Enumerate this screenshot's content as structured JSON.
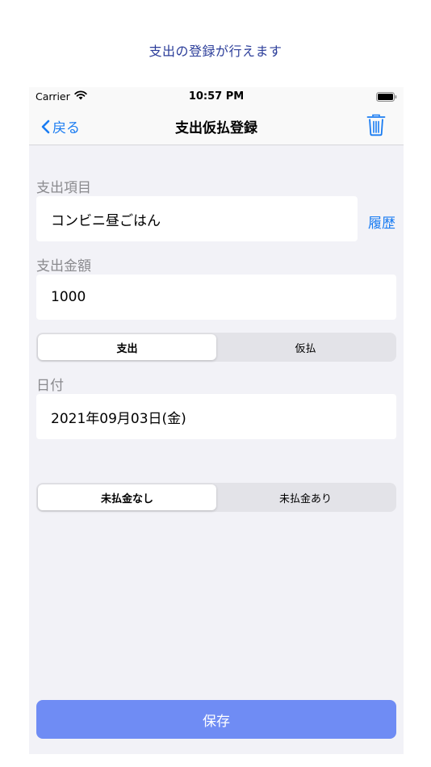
{
  "caption": "支出の登録が行えます",
  "status_bar": {
    "carrier": "Carrier",
    "time": "10:57 PM"
  },
  "nav": {
    "back_label": "戻る",
    "title": "支出仮払登録"
  },
  "form": {
    "item_label": "支出項目",
    "item_value": "コンビニ昼ごはん",
    "history_label": "履歴",
    "amount_label": "支出金額",
    "amount_value": "1000",
    "type_segments": {
      "options": [
        "支出",
        "仮払"
      ],
      "selected": "支出"
    },
    "date_label": "日付",
    "date_value": "2021年09月03日(金)",
    "unpaid_segments": {
      "options": [
        "未払金なし",
        "未払金あり"
      ],
      "selected": "未払金なし"
    }
  },
  "save_label": "保存",
  "colors": {
    "accent": "#1a7cf2",
    "save_button": "#6f8cf4",
    "caption": "#2c3e9a",
    "background": "#f2f2f7"
  },
  "icons": {
    "back": "chevron-left-icon",
    "trash": "trash-icon",
    "wifi": "wifi-icon",
    "battery": "battery-icon"
  }
}
